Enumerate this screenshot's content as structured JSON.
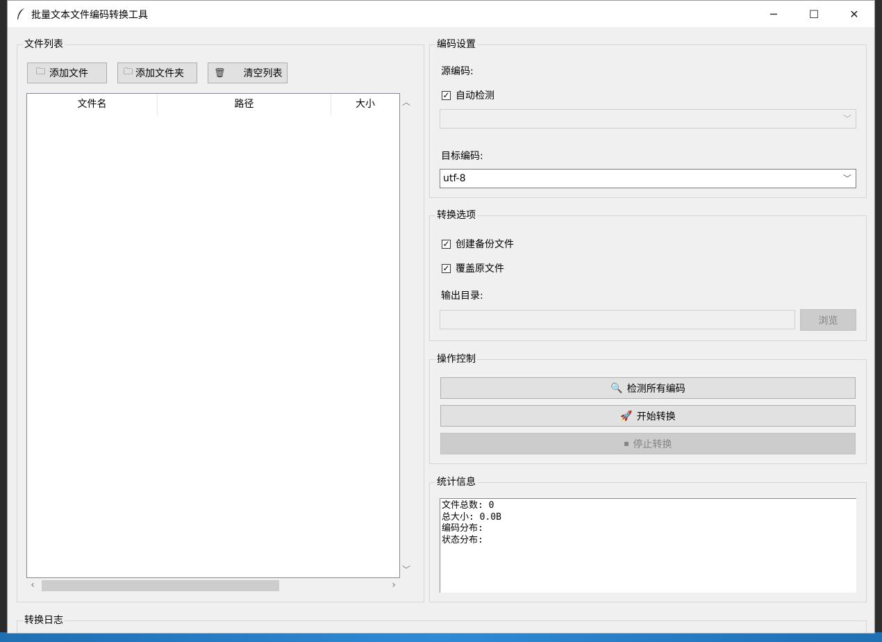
{
  "window": {
    "title": "批量文本文件编码转换工具",
    "controls": {
      "minimize": "─",
      "maximize": "☐",
      "close": "✕"
    }
  },
  "file_list": {
    "title": "文件列表",
    "buttons": {
      "add_file": "添加文件",
      "add_folder": "添加文件夹",
      "clear_list": "清空列表"
    },
    "columns": [
      "文件名",
      "路径",
      "大小"
    ],
    "rows": []
  },
  "encoding": {
    "title": "编码设置",
    "source_label": "源编码:",
    "auto_detect_label": "自动检测",
    "auto_detect_checked": true,
    "source_value": "",
    "target_label": "目标编码:",
    "target_value": "utf-8"
  },
  "options": {
    "title": "转换选项",
    "backup_label": "创建备份文件",
    "backup_checked": true,
    "overwrite_label": "覆盖原文件",
    "overwrite_checked": true,
    "output_label": "输出目录:",
    "output_value": "",
    "browse_label": "浏览"
  },
  "controls": {
    "title": "操作控制",
    "detect_label": "检测所有编码",
    "start_label": "开始转换",
    "stop_label": "停止转换"
  },
  "stats": {
    "title": "统计信息",
    "lines": [
      "文件总数: 0",
      "总大小: 0.0B",
      "",
      "编码分布:",
      "",
      "状态分布:"
    ]
  },
  "log": {
    "title": "转换日志"
  }
}
